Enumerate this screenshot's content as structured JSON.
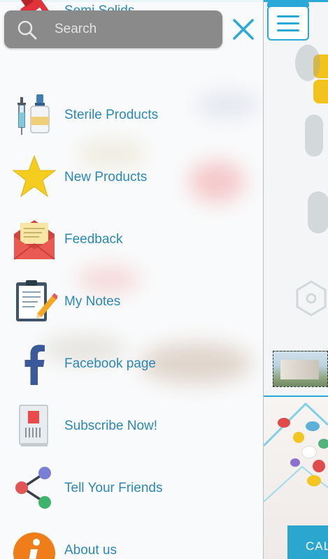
{
  "search": {
    "placeholder": "Search"
  },
  "drawer": {
    "items": [
      {
        "label": "Semi Solids",
        "icon": "tube-icon"
      },
      {
        "label": "Sterile Products",
        "icon": "syringe-vial-icon"
      },
      {
        "label": "New Products",
        "icon": "star-icon"
      },
      {
        "label": "Feedback",
        "icon": "envelope-icon"
      },
      {
        "label": "My Notes",
        "icon": "clipboard-pencil-icon"
      },
      {
        "label": "Facebook page",
        "icon": "facebook-icon"
      },
      {
        "label": "Subscribe Now!",
        "icon": "newspaper-icon"
      },
      {
        "label": "Tell Your Friends",
        "icon": "share-icon"
      },
      {
        "label": "About us",
        "icon": "info-icon"
      }
    ]
  },
  "background_app": {
    "cta_label": "CAL"
  },
  "colors": {
    "accent": "#2aa8d8",
    "label": "#2a88b8",
    "search_bg": "#8a8a8a"
  }
}
